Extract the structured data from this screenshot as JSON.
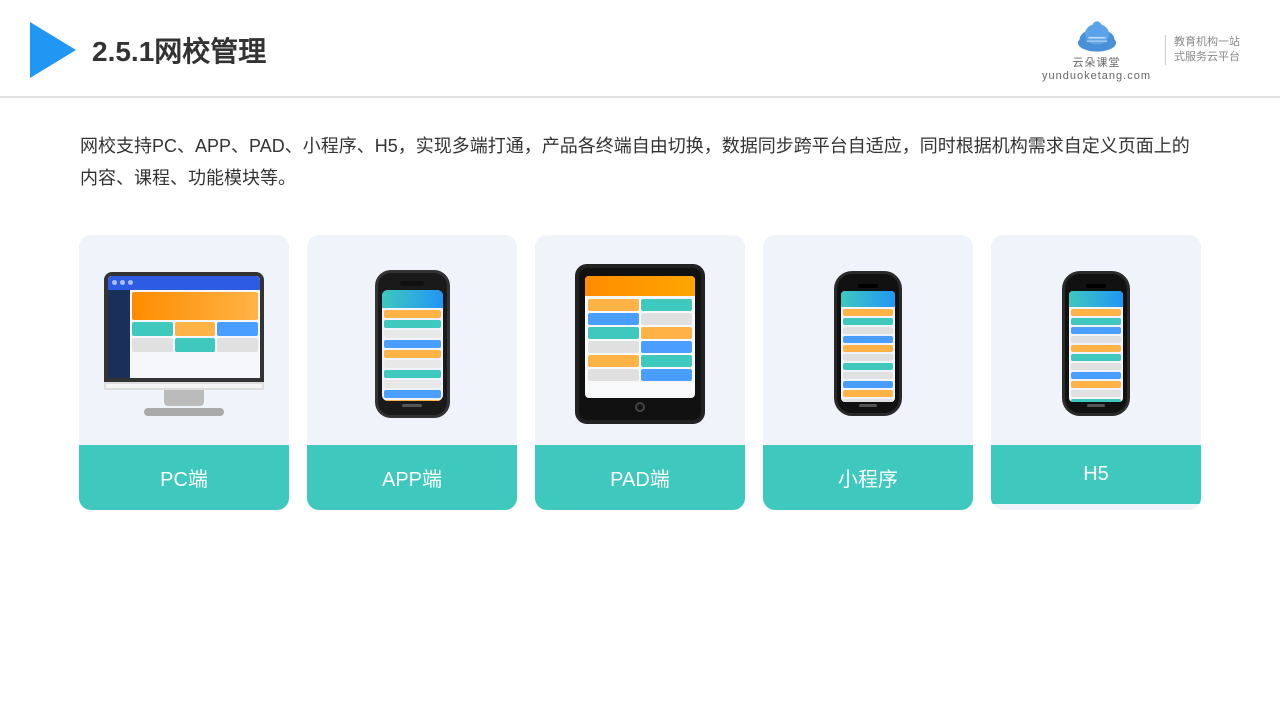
{
  "header": {
    "title": "2.5.1网校管理",
    "brand": {
      "name": "云朵课堂",
      "url": "yunduoketang.com",
      "tagline_line1": "教育机构一站",
      "tagline_line2": "式服务云平台"
    }
  },
  "description": {
    "text": "网校支持PC、APP、PAD、小程序、H5，实现多端打通，产品各终端自由切换，数据同步跨平台自适应，同时根据机构需求自定义页面上的内容、课程、功能模块等。"
  },
  "cards": [
    {
      "id": "pc",
      "label": "PC端"
    },
    {
      "id": "app",
      "label": "APP端"
    },
    {
      "id": "pad",
      "label": "PAD端"
    },
    {
      "id": "miniprogram",
      "label": "小程序"
    },
    {
      "id": "h5",
      "label": "H5"
    }
  ],
  "colors": {
    "accent_teal": "#3ec8be",
    "accent_blue": "#2196F3",
    "background_card": "#f0f4fa",
    "text_dark": "#333333",
    "triangle_blue": "#2196F3"
  }
}
